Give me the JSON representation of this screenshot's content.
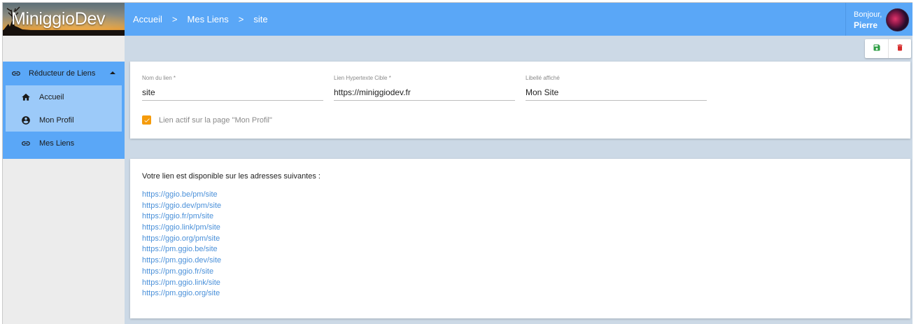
{
  "header": {
    "brand": "MiniggioDev",
    "breadcrumb": [
      "Accueil",
      "Mes Liens",
      "site"
    ],
    "breadcrumb_separator": ">",
    "greeting": "Bonjour,",
    "user_name": "Pierre"
  },
  "sidebar": {
    "group_label": "Réducteur de Liens",
    "items": [
      {
        "label": "Accueil",
        "icon": "home-icon"
      },
      {
        "label": "Mon Profil",
        "icon": "account-circle-icon"
      },
      {
        "label": "Mes Liens",
        "icon": "link-icon"
      }
    ]
  },
  "toolbar": {
    "save_icon": "save-icon",
    "delete_icon": "delete-icon",
    "save_color": "#2e9e44",
    "delete_color": "#d62b2b"
  },
  "form": {
    "name_label": "Nom du lien *",
    "name_value": "site",
    "target_label": "Lien Hypertexte Cible *",
    "target_value": "https://miniggiodev.fr",
    "display_label": "Libellé affiché",
    "display_value": "Mon Site",
    "active_label": "Lien actif sur la page \"Mon Profil\"",
    "active_checked": true
  },
  "links": {
    "intro": "Votre lien est disponible sur les adresses suivantes :",
    "urls": [
      "https://ggio.be/pm/site",
      "https://ggio.dev/pm/site",
      "https://ggio.fr/pm/site",
      "https://ggio.link/pm/site",
      "https://ggio.org/pm/site",
      "https://pm.ggio.be/site",
      "https://pm.ggio.dev/site",
      "https://pm.ggio.fr/site",
      "https://pm.ggio.link/site",
      "https://pm.ggio.org/site"
    ]
  },
  "colors": {
    "primary": "#5aa7f7",
    "selected": "#9ccaf9",
    "checkbox": "#f59b0b",
    "link": "#4a90d9"
  }
}
